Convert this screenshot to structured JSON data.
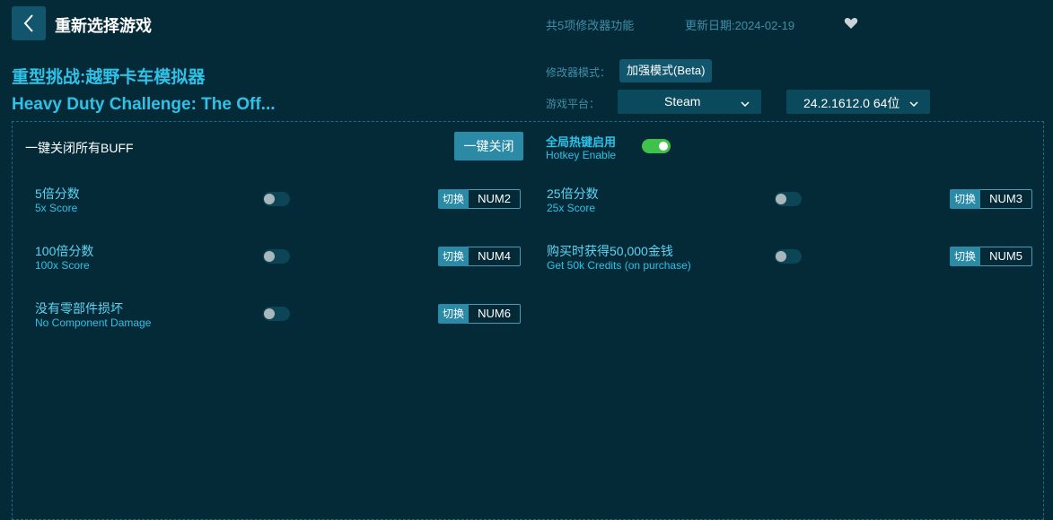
{
  "header": {
    "back_icon": "chevron-left-icon",
    "title": "重新选择游戏",
    "feature_count": "共5项修改器功能",
    "update_date": "更新日期:2024-02-19",
    "favorite_icon": "heart-icon"
  },
  "game": {
    "name_cn": "重型挑战:越野卡车模拟器",
    "name_en": "Heavy Duty Challenge: The Off..."
  },
  "settings": {
    "mode_label": "修改器模式：",
    "mode_value": "加强模式(Beta)",
    "platform_label": "游戏平台：",
    "platform_value": "Steam",
    "version_value": "24.2.1612.0 64位"
  },
  "panel": {
    "buff_label": "一键关闭所有BUFF",
    "close_all_label": "一键关闭",
    "hotkey_cn": "全局热键启用",
    "hotkey_en": "Hotkey Enable",
    "hotkey_enabled": true
  },
  "options": [
    {
      "cn": "5倍分数",
      "en": "5x Score",
      "switch": "切换",
      "key": "NUM2",
      "enabled": false
    },
    {
      "cn": "25倍分数",
      "en": "25x Score",
      "switch": "切换",
      "key": "NUM3",
      "enabled": false
    },
    {
      "cn": "100倍分数",
      "en": "100x Score",
      "switch": "切换",
      "key": "NUM4",
      "enabled": false
    },
    {
      "cn": "购买时获得50,000金钱",
      "en": "Get 50k Credits (on purchase)",
      "switch": "切换",
      "key": "NUM5",
      "enabled": false
    },
    {
      "cn": "没有零部件损坏",
      "en": "No Component Damage",
      "switch": "切换",
      "key": "NUM6",
      "enabled": false
    }
  ],
  "colors": {
    "background": "#042a38",
    "accent": "#2fc1e6",
    "button": "#2b8aa6",
    "toggle_on": "#3fc24a"
  }
}
